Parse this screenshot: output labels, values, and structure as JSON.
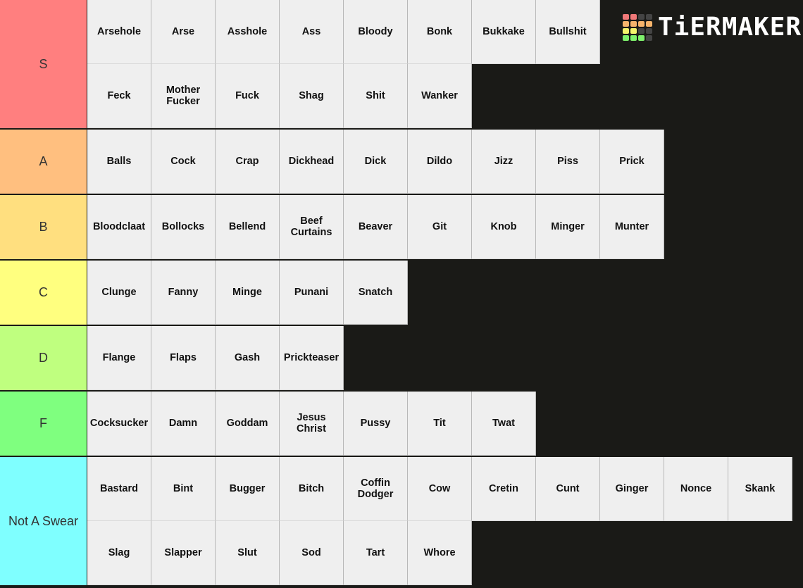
{
  "brand": {
    "logo_text": "TiERMAKER",
    "logo_colors": [
      [
        "#f07878",
        "#f07878",
        "#444444",
        "#444444"
      ],
      [
        "#f6b46c",
        "#f6b46c",
        "#f6b46c",
        "#f6b46c"
      ],
      [
        "#f4f46c",
        "#f4f46c",
        "#444444",
        "#444444"
      ],
      [
        "#7ef06c",
        "#7ef06c",
        "#7ef06c",
        "#444444"
      ]
    ]
  },
  "tiers": [
    {
      "label": "S",
      "color": "#ff7f7f",
      "rows": 2,
      "items": [
        "Arsehole",
        "Arse",
        "Asshole",
        "Ass",
        "Bloody",
        "Bonk",
        "Bukkake",
        "Bullshit",
        "Feck",
        "Mother\nFucker",
        "Fuck",
        "Shag",
        "Shit",
        "Wanker"
      ],
      "row_break_after": 8
    },
    {
      "label": "A",
      "color": "#ffbf7f",
      "rows": 1,
      "items": [
        "Balls",
        "Cock",
        "Crap",
        "Dickhead",
        "Dick",
        "Dildo",
        "Jizz",
        "Piss",
        "Prick"
      ]
    },
    {
      "label": "B",
      "color": "#ffdf7f",
      "rows": 1,
      "items": [
        "Bloodclaat",
        "Bollocks",
        "Bellend",
        "Beef\nCurtains",
        "Beaver",
        "Git",
        "Knob",
        "Minger",
        "Munter"
      ]
    },
    {
      "label": "C",
      "color": "#ffff7f",
      "rows": 1,
      "items": [
        "Clunge",
        "Fanny",
        "Minge",
        "Punani",
        "Snatch"
      ]
    },
    {
      "label": "D",
      "color": "#bfff7f",
      "rows": 1,
      "items": [
        "Flange",
        "Flaps",
        "Gash",
        "Prickteaser"
      ]
    },
    {
      "label": "F",
      "color": "#7fff7f",
      "rows": 1,
      "items": [
        "Cocksucker",
        "Damn",
        "Goddam",
        "Jesus\nChrist",
        "Pussy",
        "Tit",
        "Twat"
      ]
    },
    {
      "label": "Not A Swear",
      "color": "#7fffff",
      "rows": 2,
      "items": [
        "Bastard",
        "Bint",
        "Bugger",
        "Bitch",
        "Coffin\nDodger",
        "Cow",
        "Cretin",
        "Cunt",
        "Ginger",
        "Nonce",
        "Skank",
        "Slag",
        "Slapper",
        "Slut",
        "Sod",
        "Tart",
        "Whore"
      ]
    }
  ]
}
